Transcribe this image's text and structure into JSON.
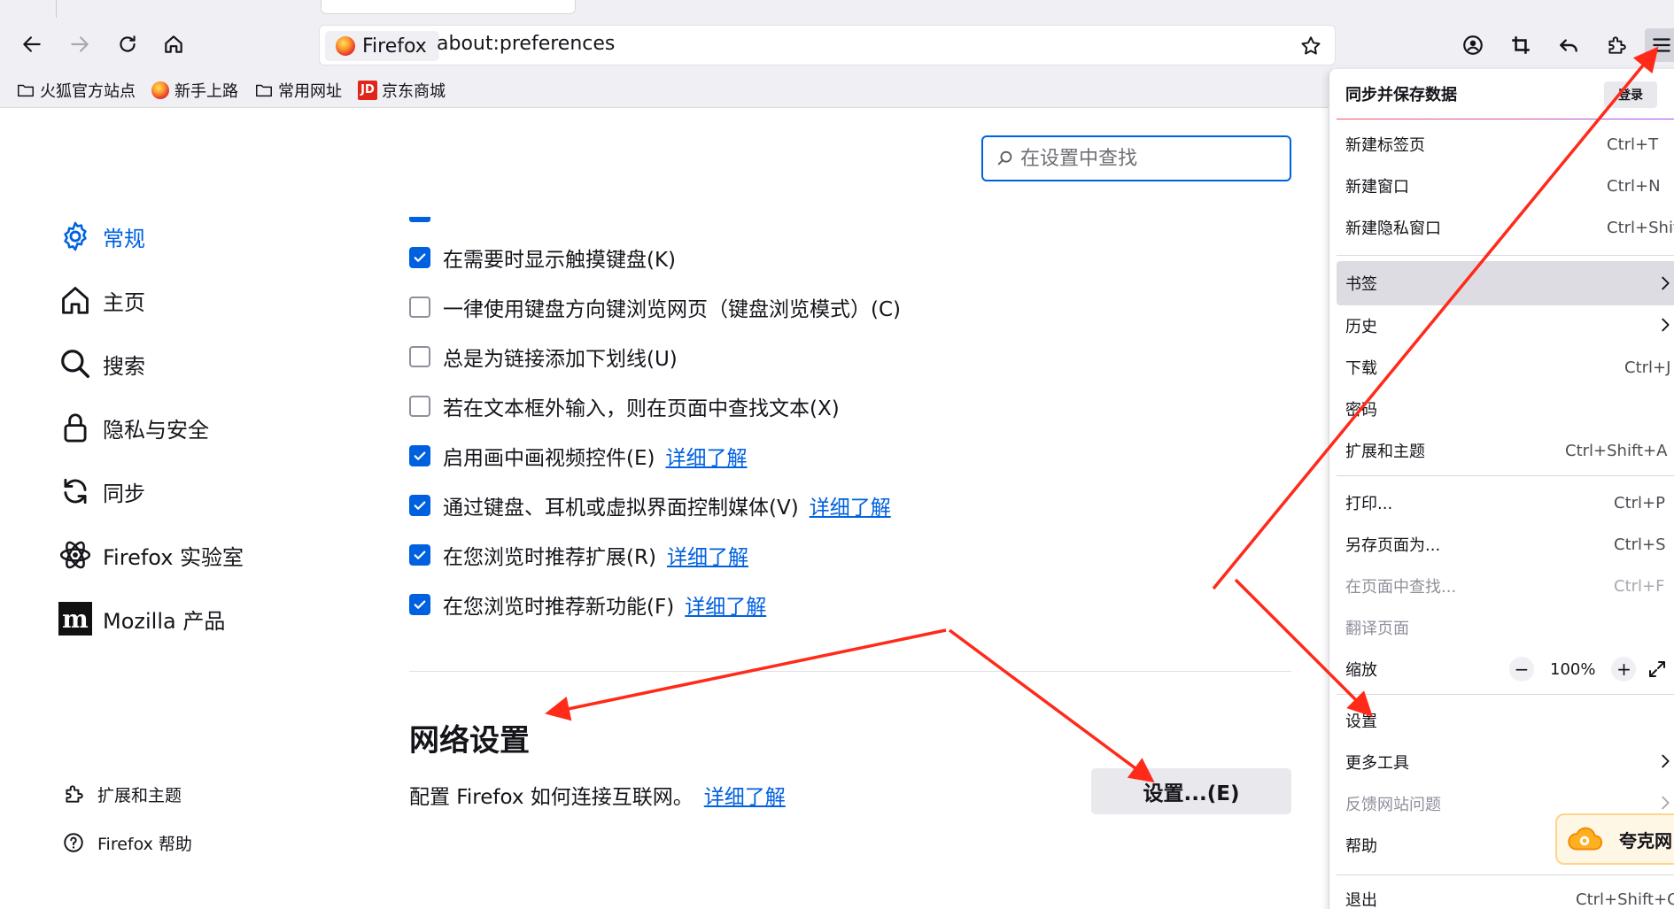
{
  "browser": {
    "url": "about:preferences",
    "identity_label": "Firefox"
  },
  "bookmarks": [
    {
      "label": "火狐官方站点",
      "icon": "folder-icon"
    },
    {
      "label": "新手上路",
      "icon": "firefox-icon"
    },
    {
      "label": "常用网址",
      "icon": "folder-icon"
    },
    {
      "label": "京东商城",
      "icon": "jd-icon",
      "icon_text": "JD"
    }
  ],
  "search": {
    "placeholder": "在设置中查找"
  },
  "sidebar": {
    "categories": [
      {
        "label": "常规",
        "icon": "gear-icon",
        "selected": true
      },
      {
        "label": "主页",
        "icon": "home-icon"
      },
      {
        "label": "搜索",
        "icon": "search-icon"
      },
      {
        "label": "隐私与安全",
        "icon": "lock-icon"
      },
      {
        "label": "同步",
        "icon": "sync-icon"
      },
      {
        "label": "Firefox 实验室",
        "icon": "labs-icon"
      },
      {
        "label": "Mozilla 产品",
        "icon": "mozilla-icon",
        "icon_text": "m"
      }
    ],
    "footer": [
      {
        "label": "扩展和主题",
        "icon": "puzzle-icon"
      },
      {
        "label": "Firefox 帮助",
        "icon": "help-icon"
      }
    ]
  },
  "browsing_options": [
    {
      "label": "在需要时显示触摸键盘(K)",
      "checked": true
    },
    {
      "label": "一律使用键盘方向键浏览网页（键盘浏览模式）(C)",
      "checked": false
    },
    {
      "label": "总是为链接添加下划线(U)",
      "checked": false
    },
    {
      "label": "若在文本框外输入，则在页面中查找文本(X)",
      "checked": false
    },
    {
      "label": "启用画中画视频控件(E)",
      "checked": true,
      "link": "详细了解"
    },
    {
      "label": "通过键盘、耳机或虚拟界面控制媒体(V)",
      "checked": true,
      "link": "详细了解"
    },
    {
      "label": "在您浏览时推荐扩展(R)",
      "checked": true,
      "link": "详细了解"
    },
    {
      "label": "在您浏览时推荐新功能(F)",
      "checked": true,
      "link": "详细了解"
    }
  ],
  "network": {
    "title": "网络设置",
    "description": "配置 Firefox 如何连接互联网。",
    "link": "详细了解",
    "button": "设置...(E)"
  },
  "app_menu": {
    "header": "同步并保存数据",
    "login": "登录",
    "items": [
      {
        "label": "新建标签页",
        "shortcut": "Ctrl+T"
      },
      {
        "label": "新建窗口",
        "shortcut": "Ctrl+N"
      },
      {
        "label": "新建隐私窗口",
        "shortcut": "Ctrl+Shift+P"
      },
      {
        "label": "书签",
        "submenu": true
      },
      {
        "label": "历史",
        "submenu": true
      },
      {
        "label": "下载",
        "shortcut": "Ctrl+J"
      },
      {
        "label": "密码"
      },
      {
        "label": "扩展和主题",
        "shortcut": "Ctrl+Shift+A"
      },
      {
        "label": "打印...",
        "shortcut": "Ctrl+P"
      },
      {
        "label": "另存页面为...",
        "shortcut": "Ctrl+S"
      },
      {
        "label": "在页面中查找...",
        "shortcut": "Ctrl+F",
        "disabled": true
      },
      {
        "label": "翻译页面",
        "disabled": true
      },
      {
        "label": "缩放"
      },
      {
        "label": "设置"
      },
      {
        "label": "更多工具",
        "submenu": true
      },
      {
        "label": "反馈网站问题",
        "submenu": true,
        "disabled": true
      },
      {
        "label": "帮助"
      },
      {
        "label": "退出",
        "shortcut": "Ctrl+Shift+Q"
      }
    ],
    "zoom": {
      "minus": "−",
      "value": "100%",
      "plus": "+"
    },
    "quark_label": "夸克网"
  },
  "colors": {
    "accent": "#0061e0",
    "annotation": "#ff2a1a"
  }
}
